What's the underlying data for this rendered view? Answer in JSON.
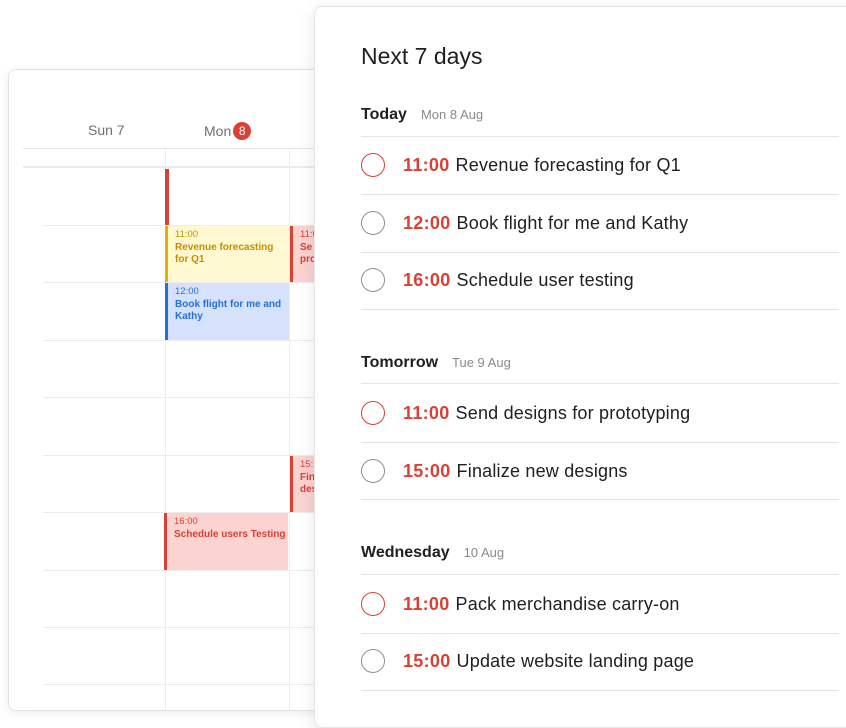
{
  "calendar": {
    "days": [
      {
        "label": "Sun 7"
      },
      {
        "label": "Mon",
        "badge": "8"
      }
    ],
    "events": [
      {
        "time": "11:00",
        "title": "Revenue forecasting for Q1",
        "color": "#e3b000"
      },
      {
        "time": "12:00",
        "title": "Book flight for me and Kathy",
        "color": "#246fe0"
      },
      {
        "time": "16:00",
        "title": "Schedule users Testing",
        "color": "#db4035"
      },
      {
        "time": "11:0",
        "title": "Se pro",
        "color": "#db4035"
      },
      {
        "time": "15:",
        "title": "Fin des",
        "color": "#db4035"
      }
    ]
  },
  "next7": {
    "title": "Next 7 days",
    "sections": [
      {
        "name": "Today",
        "date": "Mon 8 Aug",
        "tasks": [
          {
            "time": "11:00",
            "title": "Revenue forecasting for Q1",
            "priority": "red"
          },
          {
            "time": "12:00",
            "title": "Book flight for me and Kathy",
            "priority": "grey"
          },
          {
            "time": "16:00",
            "title": "Schedule user testing",
            "priority": "grey"
          }
        ]
      },
      {
        "name": "Tomorrow",
        "date": "Tue 9 Aug",
        "tasks": [
          {
            "time": "11:00",
            "title": "Send designs for prototyping",
            "priority": "red"
          },
          {
            "time": "15:00",
            "title": "Finalize new designs",
            "priority": "grey"
          }
        ]
      },
      {
        "name": "Wednesday",
        "date": "10 Aug",
        "tasks": [
          {
            "time": "11:00",
            "title": "Pack merchandise carry-on",
            "priority": "red"
          },
          {
            "time": "15:00",
            "title": "Update website landing page",
            "priority": "grey"
          }
        ]
      }
    ]
  },
  "colors": {
    "accent": "#db4035",
    "yellow": "#e3b000",
    "blue": "#246fe0"
  }
}
